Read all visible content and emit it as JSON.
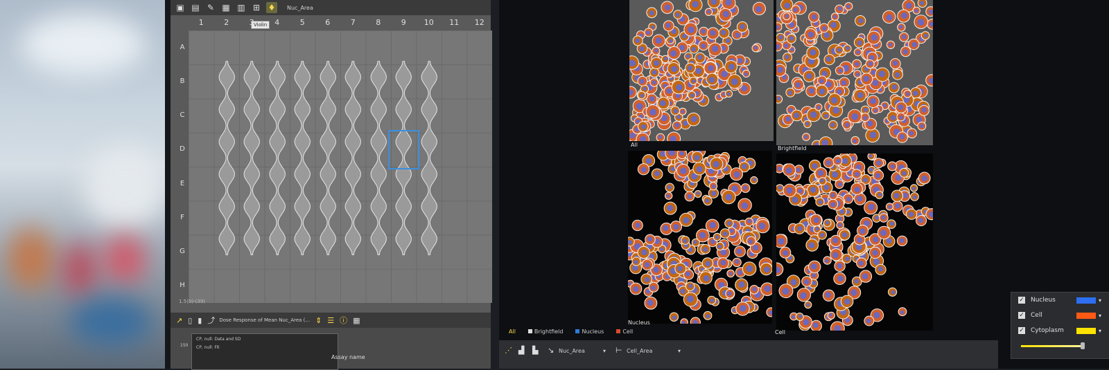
{
  "toolbar": {
    "icons": [
      "image-icon",
      "table-icon",
      "paint-icon",
      "grid-icon",
      "layout-icon",
      "well-icon",
      "violin-icon"
    ],
    "measure_label": "Nuc_Area",
    "tooltip": "Violin"
  },
  "plate": {
    "columns": [
      "1",
      "2",
      "3",
      "4",
      "5",
      "6",
      "7",
      "8",
      "9",
      "10",
      "11",
      "12"
    ],
    "rows": [
      "A",
      "B",
      "C",
      "D",
      "E",
      "F",
      "G",
      "H"
    ],
    "selected_well": "D9",
    "status": "1.5(0)-(39)"
  },
  "bottom_toolbar": {
    "dose_label": "Dose Response of Mean Nuc_Area (...",
    "chart_series": [
      "CP, null: Data and SD",
      "CP, null: Fit"
    ],
    "y_tick": "150",
    "assay_label": "Assay name"
  },
  "images": [
    {
      "label": "All"
    },
    {
      "label": "Brightfield"
    },
    {
      "label": "Nucleus"
    },
    {
      "label": "Cell"
    }
  ],
  "channel_tabs": [
    {
      "label": "All",
      "color": "#ffd84a"
    },
    {
      "label": "Brightfield",
      "color": "#dddddd"
    },
    {
      "label": "Nucleus",
      "color": "#2d7bd8"
    },
    {
      "label": "Cell",
      "color": "#d84a2d"
    }
  ],
  "legend": [
    {
      "name": "Nucleus",
      "color": "#2e6ff2",
      "checked": true
    },
    {
      "name": "Cell",
      "color": "#ff5a14",
      "checked": true
    },
    {
      "name": "Cytoplasm",
      "color": "#ffe300",
      "checked": true
    }
  ],
  "right_toolbar": {
    "measure1": "Nuc_Area",
    "measure2": "Cell_Area"
  }
}
